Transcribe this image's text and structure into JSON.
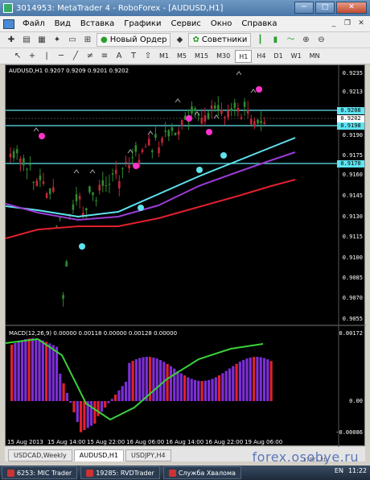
{
  "window": {
    "title": "3014953: MetaTrader 4 - RoboForex - [AUDUSD,H1]",
    "buttons": {
      "minimize": "─",
      "maximize": "□",
      "close": "✕"
    }
  },
  "menu": {
    "items": [
      "Файл",
      "Вид",
      "Вставка",
      "Графики",
      "Сервис",
      "Окно",
      "Справка"
    ],
    "mdi_buttons": [
      "_",
      "❐",
      "✕"
    ]
  },
  "toolbar": {
    "new_order": "Новый Ордер",
    "advisors": "Советники"
  },
  "timeframes": {
    "items": [
      "M1",
      "M5",
      "M15",
      "M30",
      "H1",
      "H4",
      "D1",
      "W1",
      "MN"
    ],
    "active": "H1"
  },
  "chart": {
    "symbol_info": "AUDUSD,H1  0.9207 0.9209 0.9201 0.9202",
    "price_labels": [
      "0.9235",
      "0.9213",
      "0.9190",
      "0.9175",
      "0.9160",
      "0.9145",
      "0.9130",
      "0.9115",
      "0.9100",
      "0.9085",
      "0.9070",
      "0.9055"
    ],
    "price_boxes": [
      "0.9208",
      "0.9202",
      "0.9198",
      "0.9170"
    ],
    "macd_info": "MACD(12,26,9) 0.00000 0.00118 0.00000 0.00128 0.00000",
    "macd_labels": [
      "0.00172",
      "0.00",
      "-0.00086"
    ],
    "date_labels": [
      "15 Aug 2013",
      "15 Aug 14:00",
      "15 Aug 22:00",
      "16 Aug 06:00",
      "16 Aug 14:00",
      "16 Aug 22:00",
      "19 Aug 06:00"
    ]
  },
  "tabs": {
    "items": [
      "USDCAD,Weekly",
      "AUDUSD,H1",
      "USDJPY,H4"
    ],
    "active": "AUDUSD,H1"
  },
  "status": {
    "text": "178/1 kb"
  },
  "watermark": "forex.osobye.ru",
  "taskbar": {
    "items": [
      "6253: MIC Trader",
      "19285: RVDTrader",
      "Служба Хвалома"
    ],
    "lang": "EN",
    "clock": "11:22"
  }
}
